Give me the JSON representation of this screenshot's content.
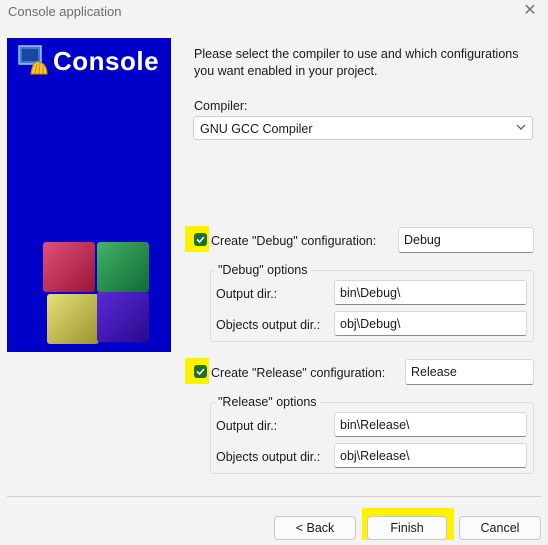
{
  "window": {
    "title": "Console application"
  },
  "banner": {
    "title": "Console"
  },
  "intro": "Please select the compiler to use and which configurations you want enabled in your project.",
  "compiler": {
    "label": "Compiler:",
    "value": "GNU GCC Compiler"
  },
  "debug": {
    "checkbox_label": "Create \"Debug\" configuration:",
    "checked": true,
    "name_value": "Debug",
    "group_title": "\"Debug\" options",
    "output_dir_label": "Output dir.:",
    "output_dir_value": "bin\\Debug\\",
    "objects_dir_label": "Objects output dir.:",
    "objects_dir_value": "obj\\Debug\\"
  },
  "release": {
    "checkbox_label": "Create \"Release\" configuration:",
    "checked": true,
    "name_value": "Release",
    "group_title": "\"Release\" options",
    "output_dir_label": "Output dir.:",
    "output_dir_value": "bin\\Release\\",
    "objects_dir_label": "Objects output dir.:",
    "objects_dir_value": "obj\\Release\\"
  },
  "buttons": {
    "back": "< Back",
    "finish": "Finish",
    "cancel": "Cancel"
  },
  "colors": {
    "banner": "#0000c8",
    "highlight": "#fff200",
    "checkbox": "#1f6e2e"
  }
}
